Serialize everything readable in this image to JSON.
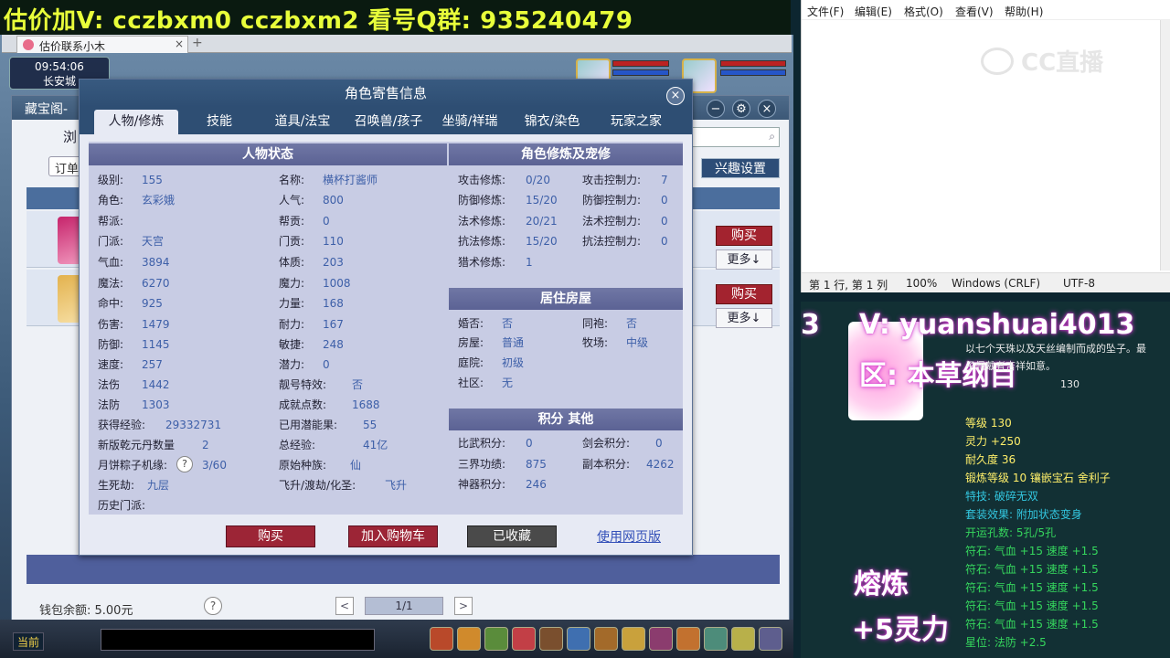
{
  "banner": {
    "text": "估价加V:  cczbxm0   cczbxm2   看号Q群:  935240479"
  },
  "browser": {
    "tab_title": "估价联系小木",
    "tab_close": "×",
    "tab_add": "+"
  },
  "hud": {
    "time": "09:54:06",
    "location": "长安城"
  },
  "cbg": {
    "window_title": "藏宝阁-",
    "search_icon": "search-icon",
    "left_text": "浏",
    "order_label": "订单",
    "interest_label": "兴趣设置",
    "buy_label": "购买",
    "more_label": "更多↓",
    "wallet_label": "钱包余额: 5.00元",
    "help": "?",
    "page": "1/1",
    "prev": "<",
    "next": ">"
  },
  "chat": {
    "channel": "当前"
  },
  "dialog": {
    "title": "角色寄售信息",
    "close": "×",
    "tabs": [
      "人物/修炼",
      "技能",
      "道具/法宝",
      "召唤兽/孩子",
      "坐骑/祥瑞",
      "锦衣/染色",
      "玩家之家"
    ],
    "sections": {
      "status": "人物状态",
      "cultivation": "角色修炼及宠修",
      "house": "居住房屋",
      "points": "积分 其他"
    },
    "status_left": [
      {
        "k": "级别:",
        "v": "155"
      },
      {
        "k": "角色:",
        "v": "玄彩娥"
      },
      {
        "k": "帮派:",
        "v": ""
      },
      {
        "k": "门派:",
        "v": "天宫"
      },
      {
        "k": "气血:",
        "v": "3894"
      },
      {
        "k": "魔法:",
        "v": "6270"
      },
      {
        "k": "命中:",
        "v": "925"
      },
      {
        "k": "伤害:",
        "v": "1479"
      },
      {
        "k": "防御:",
        "v": "1145"
      },
      {
        "k": "速度:",
        "v": "257"
      },
      {
        "k": "法伤",
        "v": "1442"
      },
      {
        "k": "法防",
        "v": "1303"
      },
      {
        "k": "获得经验:",
        "v": "29332731"
      },
      {
        "k": "新版乾元丹数量",
        "v": "2"
      },
      {
        "k": "月饼粽子机缘:",
        "v": "3/60"
      },
      {
        "k": "生死劫:",
        "v": "九层"
      },
      {
        "k": "历史门派:",
        "v": ""
      }
    ],
    "status_right": [
      {
        "k": "名称:",
        "v": "横杯打酱师"
      },
      {
        "k": "人气:",
        "v": "800"
      },
      {
        "k": "帮贡:",
        "v": "0"
      },
      {
        "k": "门贡:",
        "v": "110"
      },
      {
        "k": "体质:",
        "v": "203"
      },
      {
        "k": "魔力:",
        "v": "1008"
      },
      {
        "k": "力量:",
        "v": "168"
      },
      {
        "k": "耐力:",
        "v": "167"
      },
      {
        "k": "敏捷:",
        "v": "248"
      },
      {
        "k": "潜力:",
        "v": "0"
      },
      {
        "k": "靓号特效:",
        "v": "否"
      },
      {
        "k": "成就点数:",
        "v": "1688"
      },
      {
        "k": "已用潜能果:",
        "v": "55"
      },
      {
        "k": "总经验:",
        "v": "41亿"
      },
      {
        "k": "原始种族:",
        "v": "仙"
      },
      {
        "k": "飞升/渡劫/化圣:",
        "v": "飞升"
      }
    ],
    "cultivation_left": [
      {
        "k": "攻击修炼:",
        "v": "0/20"
      },
      {
        "k": "防御修炼:",
        "v": "15/20"
      },
      {
        "k": "法术修炼:",
        "v": "20/21"
      },
      {
        "k": "抗法修炼:",
        "v": "15/20"
      },
      {
        "k": "猎术修炼:",
        "v": "1"
      }
    ],
    "cultivation_right": [
      {
        "k": "攻击控制力:",
        "v": "7"
      },
      {
        "k": "防御控制力:",
        "v": "0"
      },
      {
        "k": "法术控制力:",
        "v": "0"
      },
      {
        "k": "抗法控制力:",
        "v": "0"
      }
    ],
    "house_left": [
      {
        "k": "婚否:",
        "v": "否"
      },
      {
        "k": "房屋:",
        "v": "普通"
      },
      {
        "k": "庭院:",
        "v": "初级"
      },
      {
        "k": "社区:",
        "v": "无"
      }
    ],
    "house_right": [
      {
        "k": "同袍:",
        "v": "否"
      },
      {
        "k": "牧场:",
        "v": "中级"
      }
    ],
    "points_left": [
      {
        "k": "比武积分:",
        "v": "0"
      },
      {
        "k": "三界功绩:",
        "v": "875"
      },
      {
        "k": "神器积分:",
        "v": "246"
      }
    ],
    "points_right": [
      {
        "k": "剑会积分:",
        "v": "0"
      },
      {
        "k": "副本积分:",
        "v": "4262"
      }
    ],
    "help": "?",
    "buy": "购买",
    "cart": "加入购物车",
    "fav": "已收藏",
    "web": "使用网页版"
  },
  "notepad": {
    "menus": [
      "文件(F)",
      "编辑(E)",
      "格式(O)",
      "查看(V)",
      "帮助(H)"
    ],
    "watermark": "CC直播",
    "status": {
      "pos": "第 1 行, 第 1 列",
      "zoom": "100%",
      "eol": "Windows (CRLF)",
      "enc": "UTF-8"
    }
  },
  "stream": {
    "overlay_prefix": "3",
    "overlay_v": "V: yuanshuai4013",
    "overlay_zone": "区: 本草纲目",
    "desc1": "以七个天珠以及天丝编制而成的坠子。最",
    "desc2": "子佩戴者吉祥如意。",
    "desc3": "130",
    "stats": [
      {
        "text": "等级 130",
        "color": "yellow"
      },
      {
        "text": "灵力 +250",
        "color": "yellow"
      },
      {
        "text": "耐久度 36",
        "color": "yellow"
      },
      {
        "text": "锻炼等级 10  镶嵌宝石 舍利子",
        "color": "yellow"
      },
      {
        "text": "特技: 破碎无双",
        "color": "green"
      },
      {
        "text": "套装效果: 附加状态变身",
        "color": "green"
      },
      {
        "text": "开运孔数: 5孔/5孔",
        "color": "green"
      },
      {
        "text": "符石: 气血 +15 速度 +1.5",
        "color": "green"
      },
      {
        "text": "符石: 气血 +15 速度 +1.5",
        "color": "green"
      },
      {
        "text": "符石: 气血 +15 速度 +1.5",
        "color": "green"
      },
      {
        "text": "符石: 气血 +15 速度 +1.5",
        "color": "green"
      },
      {
        "text": "符石: 气血 +15 速度 +1.5",
        "color": "green"
      },
      {
        "text": "星位: 法防 +2.5",
        "color": "green"
      }
    ],
    "smelt": "熔炼",
    "power": "+5灵力"
  }
}
